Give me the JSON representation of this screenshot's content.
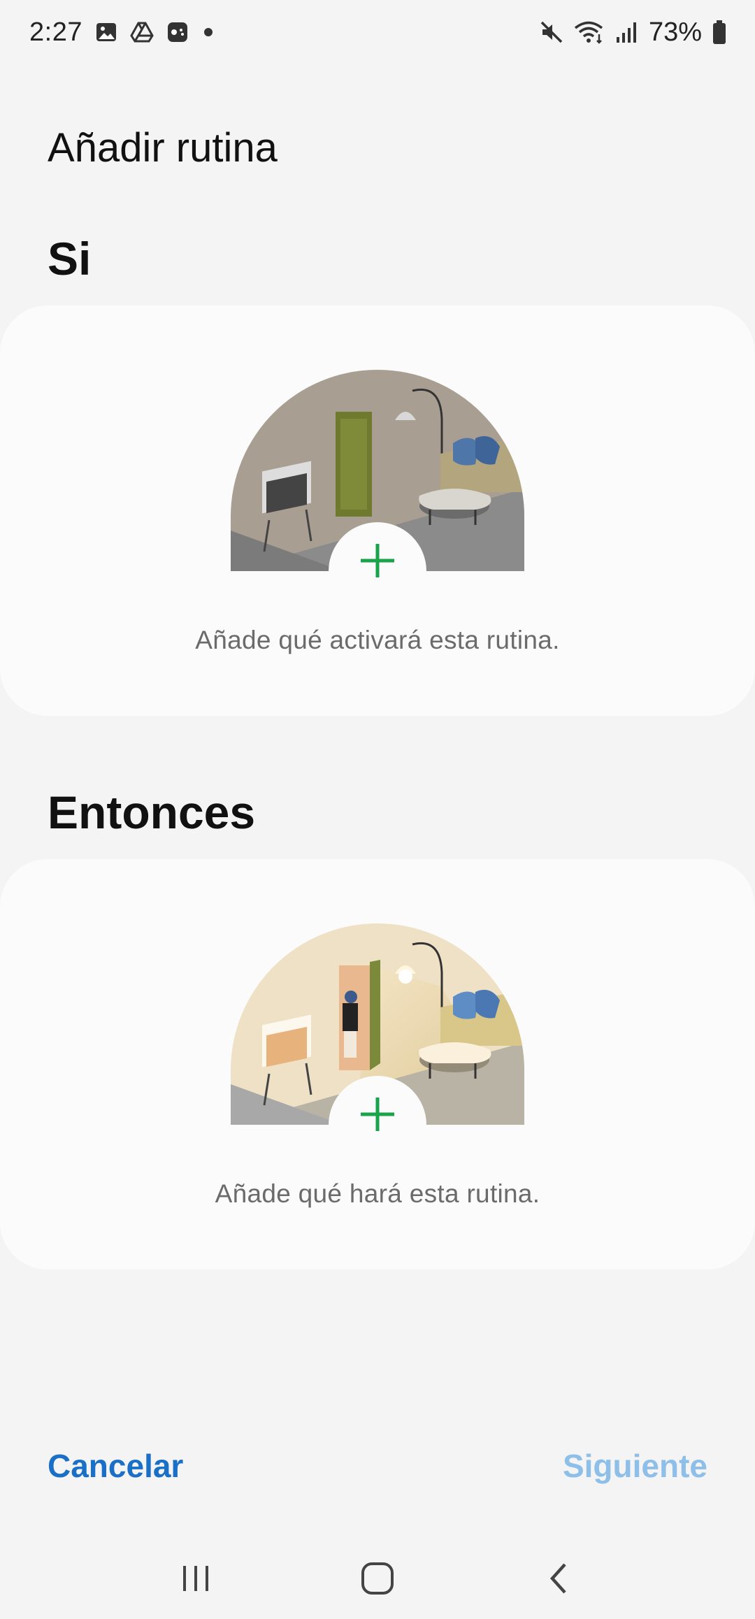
{
  "status_bar": {
    "time": "2:27",
    "battery_percent": "73%",
    "left_icons": [
      "gallery-icon",
      "drive-icon",
      "game-icon",
      "dot-icon"
    ],
    "right_icons": [
      "mute-icon",
      "wifi-icon",
      "signal-icon",
      "battery-icon"
    ]
  },
  "header": {
    "title": "Añadir rutina"
  },
  "if_section": {
    "label": "Si",
    "caption": "Añade qué activará esta rutina.",
    "add_icon": "plus-icon"
  },
  "then_section": {
    "label": "Entonces",
    "caption": "Añade qué hará esta rutina.",
    "add_icon": "plus-icon"
  },
  "footer": {
    "cancel_label": "Cancelar",
    "next_label": "Siguiente"
  },
  "nav_bar": {
    "items": [
      "recents-icon",
      "home-icon",
      "back-icon"
    ]
  },
  "colors": {
    "accent": "#1a6fc7",
    "accent_disabled": "#8ebfe8",
    "plus": "#1aa34a",
    "background": "#f4f4f4",
    "card": "#fbfbfb"
  }
}
